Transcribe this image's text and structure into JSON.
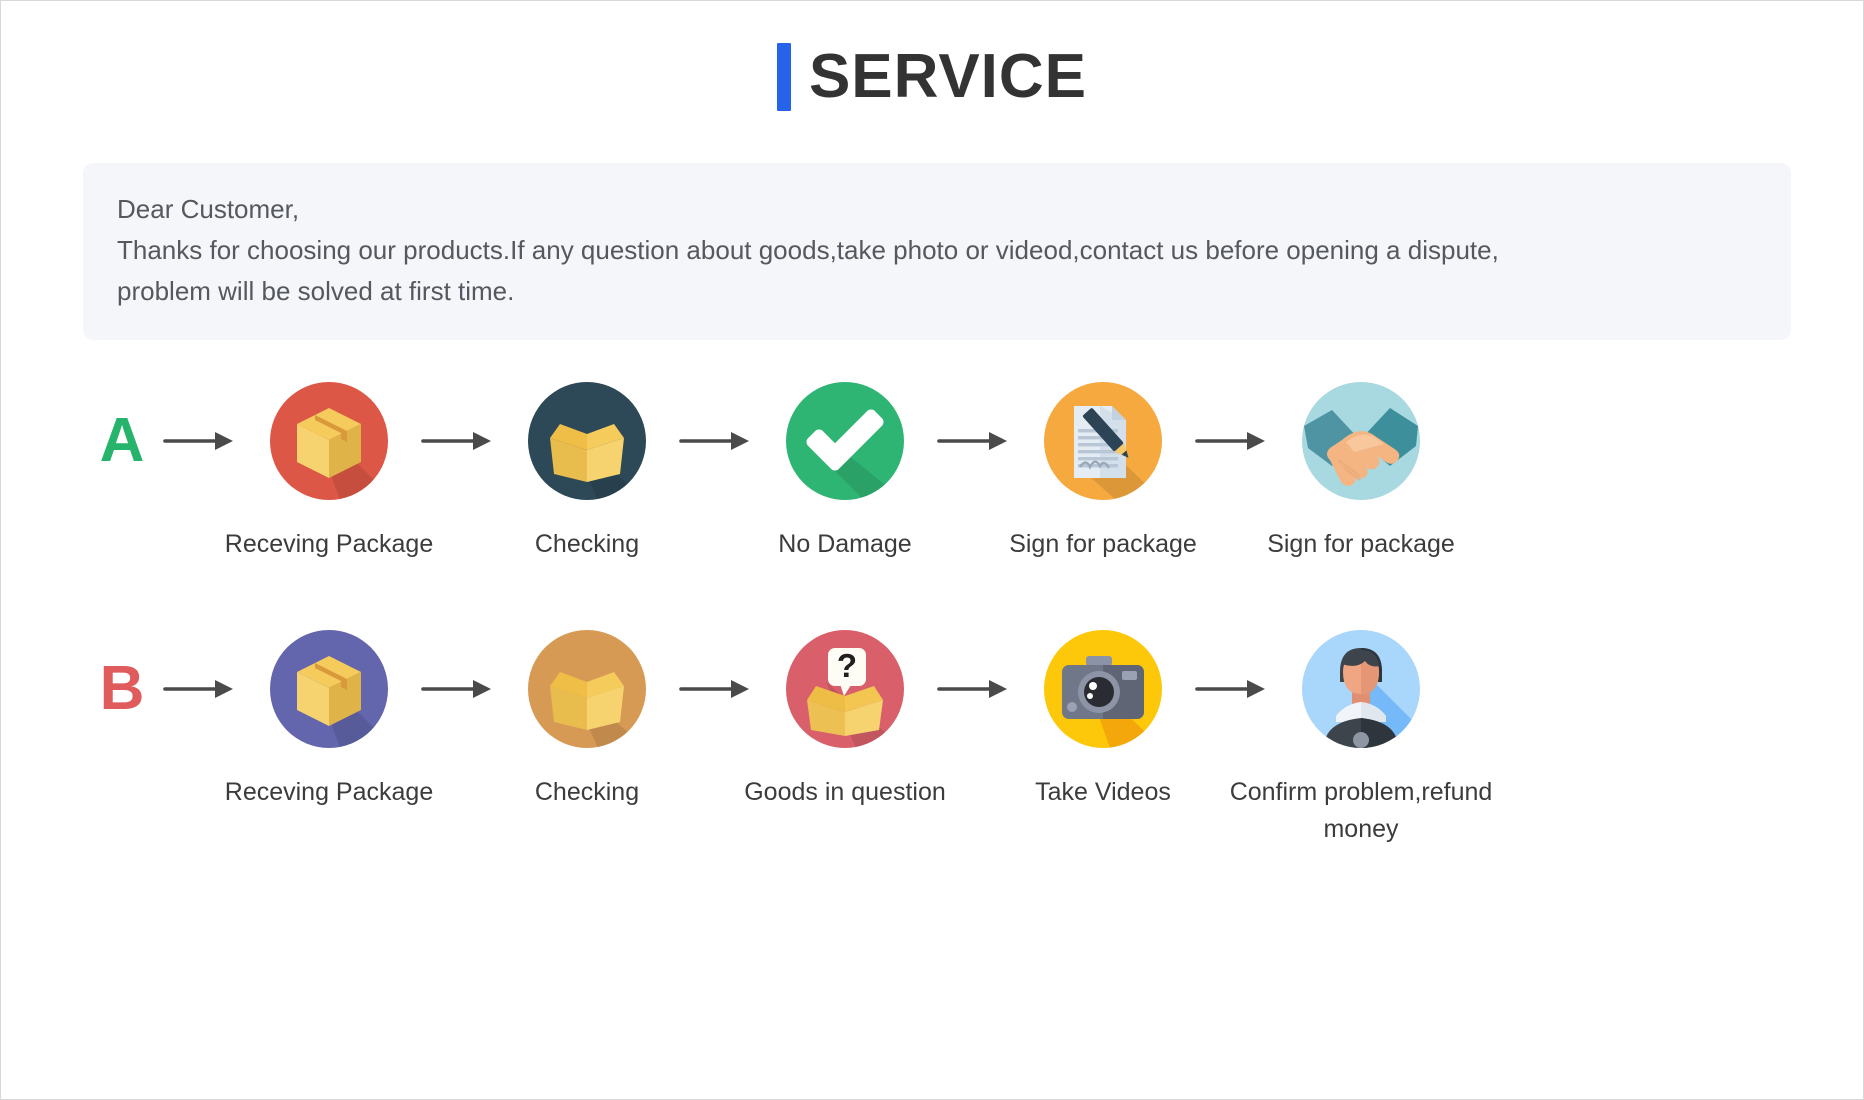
{
  "header": {
    "title": "SERVICE",
    "accent_color": "#2563eb"
  },
  "notice": {
    "line1": "Dear Customer,",
    "line2": "Thanks for choosing our products.If any question about goods,take photo or videod,contact us before opening a dispute,",
    "line3": "problem will be solved at first time."
  },
  "flows": [
    {
      "letter": "A",
      "letter_color": "#26b36b",
      "steps": [
        {
          "label": "Receving Package",
          "icon": "package-box-icon",
          "circle_color": "#dd5746"
        },
        {
          "label": "Checking",
          "icon": "open-box-icon",
          "circle_color": "#2d4856"
        },
        {
          "label": "No Damage",
          "icon": "check-mark-icon",
          "circle_color": "#2fb573"
        },
        {
          "label": "Sign for package",
          "icon": "document-signing-icon",
          "circle_color": "#f5a93f"
        },
        {
          "label": "Sign for package",
          "icon": "handshake-icon",
          "circle_color": "#a8d8e0"
        }
      ]
    },
    {
      "letter": "B",
      "letter_color": "#e05b5b",
      "steps": [
        {
          "label": "Receving Package",
          "icon": "package-box-icon",
          "circle_color": "#6366ac"
        },
        {
          "label": "Checking",
          "icon": "open-box-icon",
          "circle_color": "#d79a55"
        },
        {
          "label": "Goods in question",
          "icon": "question-box-icon",
          "circle_color": "#d9606a"
        },
        {
          "label": "Take Videos",
          "icon": "camera-icon",
          "circle_color": "#fdc70a"
        },
        {
          "label": "Confirm problem,refund money",
          "icon": "support-person-icon",
          "circle_color": "#a9d6fb"
        }
      ]
    }
  ],
  "arrow": {
    "name": "arrow-right-icon",
    "color": "#4a4a4a"
  }
}
